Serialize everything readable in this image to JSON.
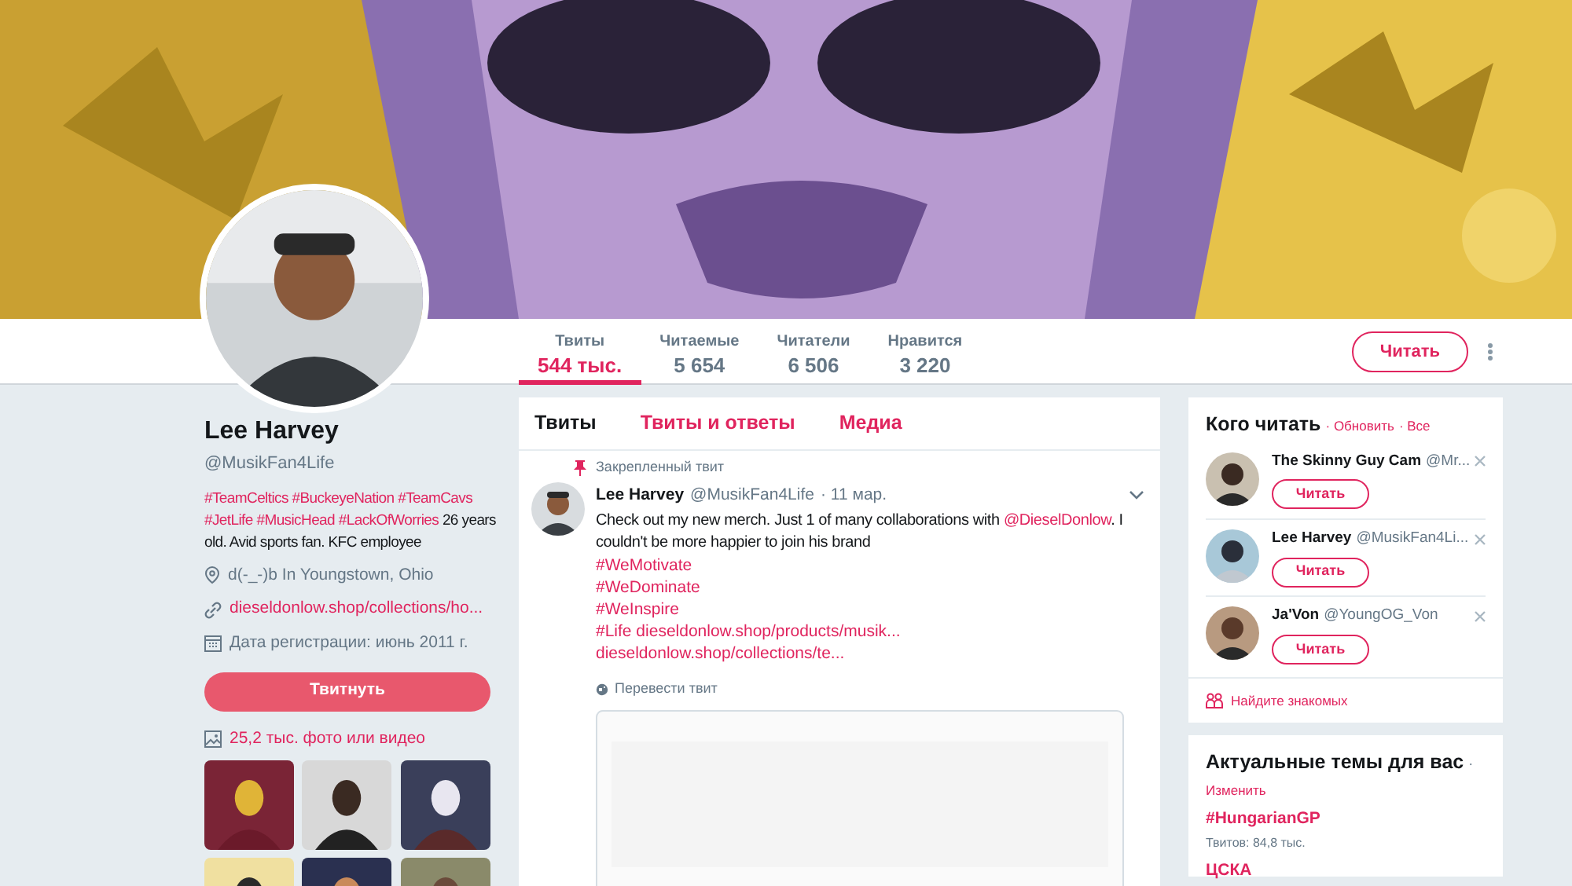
{
  "stats": [
    {
      "label": "Твиты",
      "value": "544 тыс.",
      "selected": true
    },
    {
      "label": "Читаемые",
      "value": "5 654",
      "selected": false
    },
    {
      "label": "Читатели",
      "value": "6 506",
      "selected": false
    },
    {
      "label": "Нравится",
      "value": "3 220",
      "selected": false
    }
  ],
  "follow_button": "Читать",
  "profile": {
    "name": "Lee Harvey",
    "handle": "@MusikFan4Life",
    "bio": [
      {
        "kind": "hashtag",
        "text": "#TeamCeltics"
      },
      {
        "kind": "hashtag",
        "text": "#BuckeyeNation"
      },
      {
        "kind": "hashtag",
        "text": "#TeamCavs"
      },
      {
        "kind": "hashtag",
        "text": "#JetLife"
      },
      {
        "kind": "hashtag",
        "text": "#MusicHead"
      },
      {
        "kind": "hashtag",
        "text": "#LackOfWorries"
      },
      {
        "kind": "text",
        "text": "26 years old. Avid sports fan. KFC employee"
      }
    ],
    "location": "d(-_-)b In Youngstown, Ohio",
    "website": "dieseldonlow.shop/collections/ho...",
    "joined": "Дата регистрации: июнь 2011 г.",
    "tweet_button": "Твитнуть",
    "media_link": "25,2 тыс. фото или видео"
  },
  "timeline_tabs": [
    {
      "label": "Твиты",
      "selected": true
    },
    {
      "label": "Твиты и ответы",
      "selected": false
    },
    {
      "label": "Медиа",
      "selected": false
    }
  ],
  "tweet": {
    "pinned_label": "Закрепленный твит",
    "name": "Lee Harvey",
    "handle": "@MusikFan4Life",
    "time": "· 11 мар.",
    "text": [
      {
        "kind": "text",
        "text": "Check out my new merch. Just 1 of many collaborations with "
      },
      {
        "kind": "mention",
        "text": "@DieselDonlow"
      },
      {
        "kind": "text",
        "text": ". I couldn't be more happier to join his brand"
      }
    ],
    "lines": [
      "#WeMotivate",
      "#WeDominate",
      "#WeInspire",
      "#Life dieseldonlow.shop/products/musik...",
      "dieseldonlow.shop/collections/te..."
    ],
    "translate": "Перевести твит"
  },
  "who_to_follow": {
    "title": "Кого читать",
    "refresh": "· Обновить",
    "all": "· Все",
    "users": [
      {
        "name": "The Skinny Guy Cam",
        "handle": "@Mr...",
        "button": "Читать"
      },
      {
        "name": "Lee Harvey",
        "handle": "@MusikFan4Li...",
        "button": "Читать"
      },
      {
        "name": "Ja'Von",
        "handle": "@YoungOG_Von",
        "button": "Читать"
      }
    ],
    "find_friends": "Найдите знакомых"
  },
  "trends": {
    "title": "Актуальные темы для вас",
    "dot": "·",
    "change": "Изменить",
    "items": [
      {
        "name": "#HungarianGP",
        "count": "Твитов: 84,8 тыс."
      },
      {
        "name": "ЦСКА"
      }
    ]
  }
}
